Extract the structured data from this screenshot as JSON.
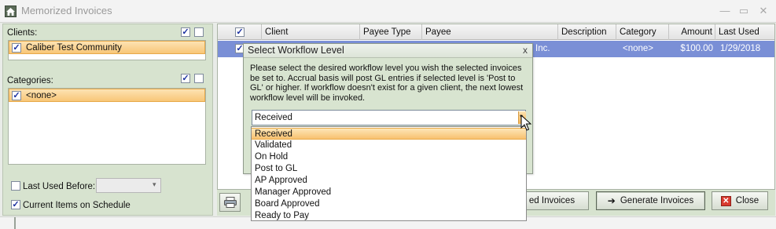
{
  "window": {
    "title": "Memorized Invoices"
  },
  "left": {
    "clients_label": "Clients:",
    "clients": [
      "Caliber Test Community"
    ],
    "categories_label": "Categories:",
    "categories": [
      "<none>"
    ],
    "last_used_label": "Last Used Before:",
    "last_used_checked": false,
    "current_items_label": "Current Items on Schedule",
    "current_items_checked": true
  },
  "grid": {
    "columns": [
      "Client",
      "Payee Type",
      "Payee",
      "Description",
      "Category",
      "Amount",
      "Last Used"
    ],
    "row": {
      "checked": true,
      "payee_fragment": "Inc.",
      "category": "<none>",
      "amount": "$100.00",
      "last_used": "1/29/2018"
    }
  },
  "buttons": {
    "invoices_fragment": "ed Invoices",
    "generate": "Generate Invoices",
    "close": "Close"
  },
  "dialog": {
    "title": "Select Workflow Level",
    "message": "Please select the desired workflow level you wish the selected invoices be set to.  Accrual basis will post GL entries if selected level is 'Post to GL' or higher.  If workflow doesn't exist for a given client, the next lowest workflow level will be invoked.",
    "selected": "Received",
    "close_glyph": "x"
  },
  "dropdown": {
    "options": [
      "Received",
      "Validated",
      "On Hold",
      "Post to GL",
      "AP Approved",
      "Manager Approved",
      "Board Approved",
      "Ready to Pay"
    ],
    "selected_index": 0
  },
  "colors": {
    "panel_green": "#d7e3cf",
    "selection_orange": "#f8c677",
    "row_highlight": "#7a8fd6"
  }
}
